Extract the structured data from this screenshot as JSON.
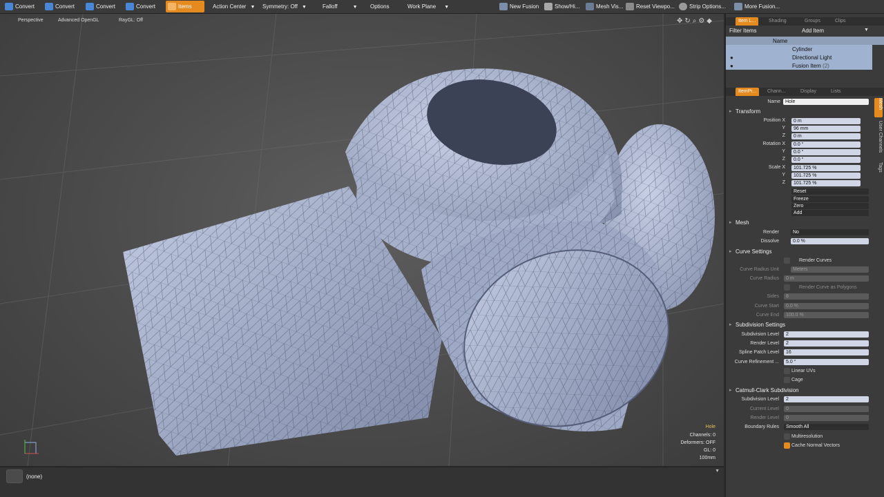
{
  "toolbar": {
    "buttons": [
      {
        "label": "Convert",
        "color": "#4a86d6"
      },
      {
        "label": "Convert",
        "color": "#4a86d6"
      },
      {
        "label": "Convert",
        "color": "#4a86d6"
      },
      {
        "label": "Convert",
        "color": "#4a86d6"
      }
    ],
    "items_label": "Items",
    "action_center": "Action Center",
    "symmetry": "Symmetry: Off",
    "falloff": "Falloff",
    "options": "Options",
    "work_plane": "Work Plane",
    "right_buttons": [
      "New Fusion",
      "Show/Hi...",
      "Mesh Vis...",
      "Reset Viewpo...",
      "Strip Options...",
      "More Fusion..."
    ]
  },
  "viewport": {
    "perspective": "Perspective",
    "render_mode": "Advanced OpenGL",
    "raygl": "RayGL: Off",
    "info": {
      "item": "Hole",
      "channels": "Channels: 0",
      "deformers": "Deformers: OFF",
      "gl": "GL: 0",
      "scale": "100mm"
    }
  },
  "status": {
    "text": "(none)"
  },
  "items_panel": {
    "tabs": [
      "Item L...",
      "Shading",
      "Groups",
      "Clips"
    ],
    "filter": "Filter Items",
    "add_item": "Add Item",
    "column_name": "Name",
    "items": [
      {
        "name": "Cylinder",
        "suffix": ""
      },
      {
        "name": "Directional Light",
        "suffix": ""
      },
      {
        "name": "Fusion Item",
        "suffix": "(2)"
      }
    ]
  },
  "props_panel": {
    "tabs": [
      "ItemPr...",
      "Chann...",
      "Display",
      "Lists"
    ],
    "vtabs": [
      "Mesh",
      "User Channels",
      "Tags"
    ],
    "name_label": "Name",
    "name_value": "Hole",
    "transform": {
      "title": "Transform",
      "position_label": "Position X",
      "position": [
        "0 m",
        "96 mm",
        "0 m"
      ],
      "rotation_label": "Rotation X",
      "rotation": [
        "0.0 °",
        "0.0 °",
        "0.0 °"
      ],
      "scale_label": "Scale X",
      "scale": [
        "101.725 %",
        "101.725 %",
        "101.725 %"
      ],
      "y": "Y",
      "z": "Z",
      "actions": [
        "Reset",
        "Freeze",
        "Zero",
        "Add"
      ]
    },
    "mesh": {
      "title": "Mesh",
      "render_label": "Render",
      "render_value": "No",
      "dissolve_label": "Dissolve",
      "dissolve_value": "0.0 %"
    },
    "curve": {
      "title": "Curve Settings",
      "render_curves": "Render Curves",
      "radius_unit_label": "Curve Radius Unit",
      "radius_unit_value": "Meters",
      "radius_label": "Curve Radius",
      "radius_value": "0 m",
      "render_as_polys": "Render Curve as Polygons",
      "sides_label": "Sides",
      "sides_value": "8",
      "start_label": "Curve Start",
      "start_value": "0.0 %",
      "end_label": "Curve End",
      "end_value": "100.0 %"
    },
    "subdiv": {
      "title": "Subdivision Settings",
      "sub_level_label": "Subdivision Level",
      "sub_level_value": "2",
      "render_level_label": "Render Level",
      "render_level_value": "2",
      "spline_label": "Spline Patch Level",
      "spline_value": "16",
      "curve_ref_label": "Curve Refinement ...",
      "curve_ref_value": "5.0 °",
      "linear_uvs": "Linear UVs",
      "cage": "Cage"
    },
    "catmull": {
      "title": "Catmull-Clark Subdivision",
      "sub_level_label": "Subdivision Level",
      "sub_level_value": "2",
      "current_label": "Current Level",
      "current_value": "0",
      "render_label": "Render Level",
      "render_value": "0",
      "boundary_label": "Boundary Rules",
      "boundary_value": "Smooth All",
      "multires": "Multiresolution",
      "cache_normals": "Cache Normal Vectors"
    }
  }
}
